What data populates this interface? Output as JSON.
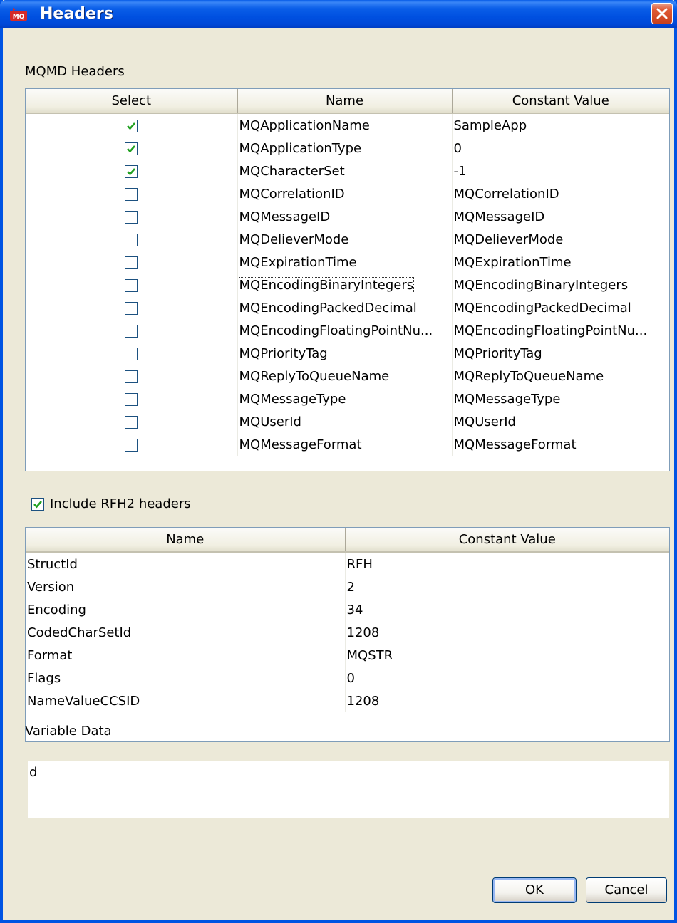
{
  "window": {
    "title": "Headers",
    "app_icon": "mq-icon",
    "close_icon": "close-icon"
  },
  "mqmd": {
    "section_label": "MQMD Headers",
    "columns": [
      "Select",
      "Name",
      "Constant Value"
    ],
    "rows": [
      {
        "selected": true,
        "name": "MQApplicationName",
        "value": "SampleApp"
      },
      {
        "selected": true,
        "name": "MQApplicationType",
        "value": "0"
      },
      {
        "selected": true,
        "name": "MQCharacterSet",
        "value": "-1"
      },
      {
        "selected": false,
        "name": "MQCorrelationID",
        "value": "MQCorrelationID"
      },
      {
        "selected": false,
        "name": "MQMessageID",
        "value": "MQMessageID"
      },
      {
        "selected": false,
        "name": "MQDelieverMode",
        "value": "MQDelieverMode"
      },
      {
        "selected": false,
        "name": "MQExpirationTime",
        "value": "MQExpirationTime"
      },
      {
        "selected": false,
        "name": "MQEncodingBinaryIntegers",
        "value": "MQEncodingBinaryIntegers",
        "focused": true
      },
      {
        "selected": false,
        "name": "MQEncodingPackedDecimal",
        "value": "MQEncodingPackedDecimal"
      },
      {
        "selected": false,
        "name": "MQEncodingFloatingPointNu...",
        "value": "MQEncodingFloatingPointNu..."
      },
      {
        "selected": false,
        "name": "MQPriorityTag",
        "value": "MQPriorityTag"
      },
      {
        "selected": false,
        "name": "MQReplyToQueueName",
        "value": "MQReplyToQueueName"
      },
      {
        "selected": false,
        "name": "MQMessageType",
        "value": "MQMessageType"
      },
      {
        "selected": false,
        "name": "MQUserId",
        "value": "MQUserId"
      },
      {
        "selected": false,
        "name": "MQMessageFormat",
        "value": "MQMessageFormat"
      }
    ]
  },
  "rfh2": {
    "include_label": "Include RFH2 headers",
    "include_checked": true,
    "columns": [
      "Name",
      "Constant Value"
    ],
    "rows": [
      {
        "name": "StructId",
        "value": "RFH"
      },
      {
        "name": "Version",
        "value": "2"
      },
      {
        "name": "Encoding",
        "value": "34"
      },
      {
        "name": "CodedCharSetId",
        "value": "1208"
      },
      {
        "name": "Format",
        "value": "MQSTR"
      },
      {
        "name": "Flags",
        "value": "0"
      },
      {
        "name": "NameValueCCSID",
        "value": "1208"
      }
    ]
  },
  "variable_data": {
    "label": "Variable Data",
    "value": "d"
  },
  "buttons": {
    "ok": "OK",
    "cancel": "Cancel"
  },
  "colors": {
    "title_bar": "#0054e3",
    "dialog_bg": "#ece9d8",
    "close_button": "#e05a36",
    "check": "#21a121"
  }
}
